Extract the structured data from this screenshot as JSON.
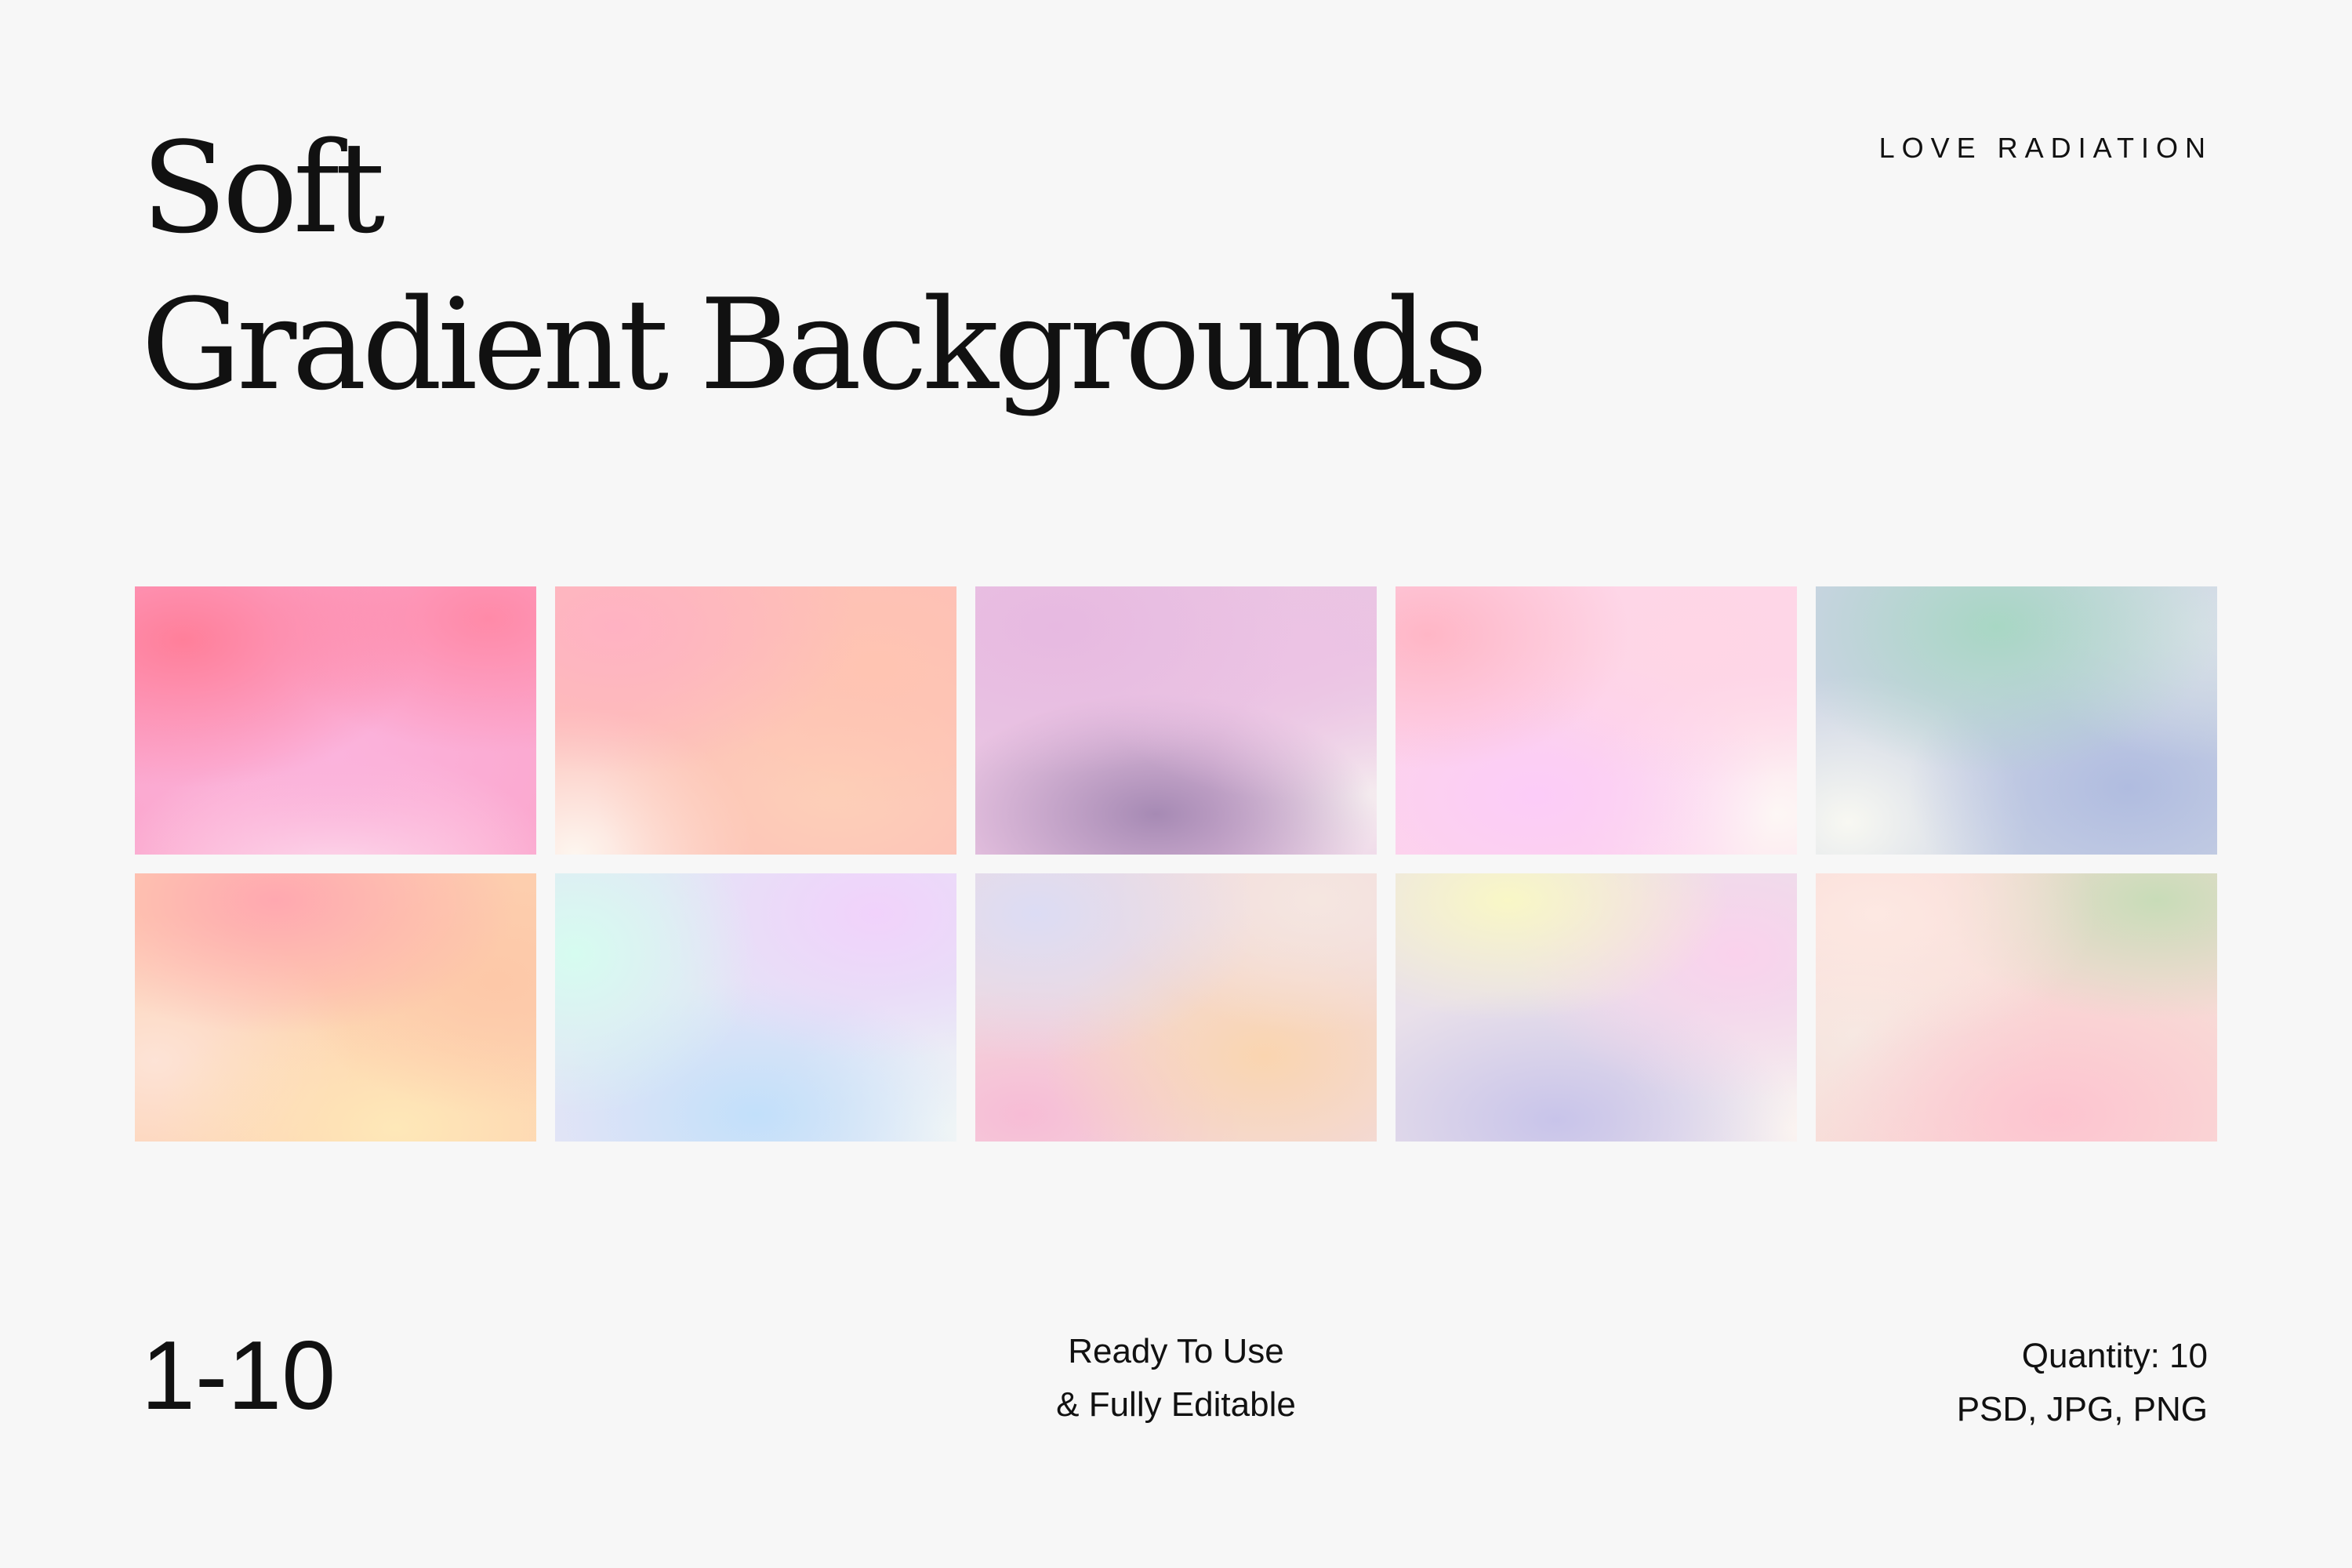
{
  "header": {
    "title_line1": "Soft",
    "title_line2": "Gradient Backgrounds",
    "brand": "LOVE RADIATION"
  },
  "footer": {
    "range": "1-10",
    "tagline_line1": "Ready To Use",
    "tagline_line2": "& Fully Editable",
    "quantity": "Quantity: 10",
    "formats": "PSD, JPG, PNG"
  },
  "colors": {
    "background": "#f7f7f7",
    "text": "#111111"
  },
  "gradients": [
    {
      "base": "#fba8cf",
      "blobs": [
        "#ff7f9a",
        "#ff8aa8",
        "#fbb3dc",
        "#fde3ef"
      ]
    },
    {
      "base": "#fdbfb8",
      "blobs": [
        "#ffb2c3",
        "#ffc4b2",
        "#fdd0b8",
        "#fdf6ef"
      ]
    },
    {
      "base": "#e9c4e2",
      "blobs": [
        "#e7b9e1",
        "#ecc3e4",
        "#a68ab4",
        "#f5ecef"
      ]
    },
    {
      "base": "#fdd5e8",
      "blobs": [
        "#ffb6c6",
        "#ffd6e6",
        "#fcccf8",
        "#fdf7f5"
      ]
    },
    {
      "base": "#cbd3e4",
      "blobs": [
        "#a8d7c4",
        "#d6e0e6",
        "#b0bce0",
        "#f8f8f2"
      ]
    },
    {
      "base": "#fdd0b0",
      "blobs": [
        "#ffa8b0",
        "#fdc8a8",
        "#fee8b8",
        "#fde3d6"
      ]
    },
    {
      "base": "#e4e4f6",
      "blobs": [
        "#d6fcf0",
        "#f1d2fb",
        "#c2e0fa",
        "#f4f7f6"
      ]
    },
    {
      "base": "#f2dadc",
      "blobs": [
        "#dcdcf4",
        "#f5e6e0",
        "#fad5b0",
        "#f7bcd6"
      ]
    },
    {
      "base": "#e9e0ea",
      "blobs": [
        "#f9f7c6",
        "#fad2ec",
        "#c8c4ea",
        "#fbf4f1"
      ]
    },
    {
      "base": "#f8dad6",
      "blobs": [
        "#fde8e2",
        "#c8dcb8",
        "#fdc4d0",
        "#f6e8e2"
      ]
    }
  ]
}
